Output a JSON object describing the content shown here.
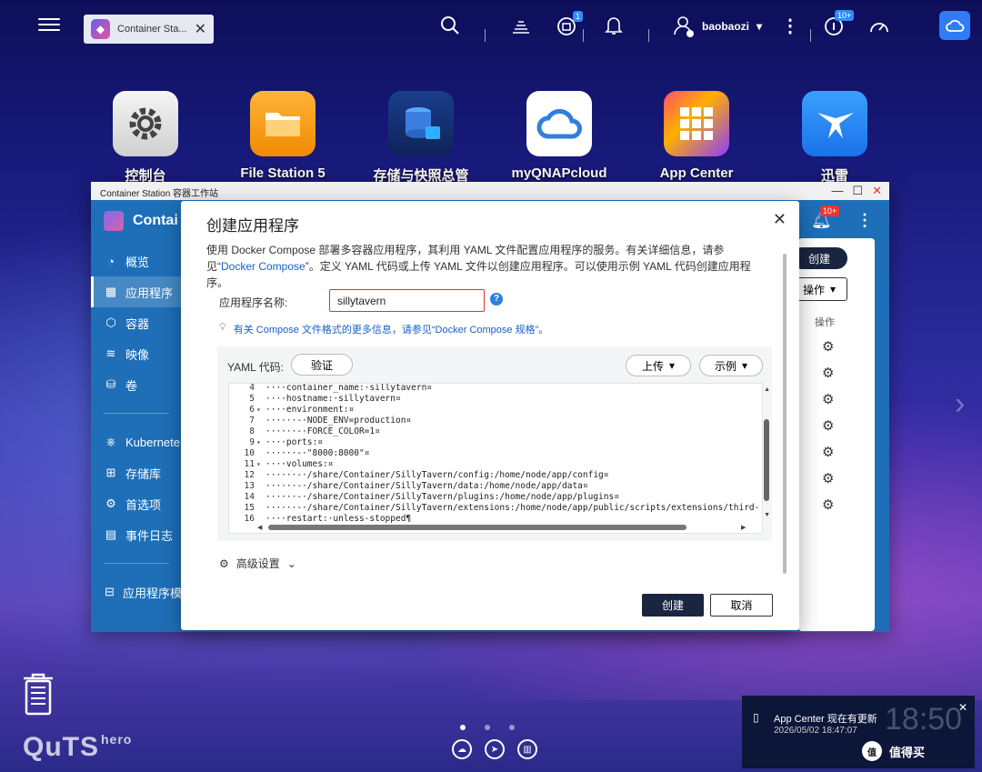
{
  "topbar": {
    "tab_label": "Container Sta...",
    "user": "baobaozi",
    "badge_updates": "1",
    "badge_notices": "10+"
  },
  "desktop": [
    {
      "label": "控制台",
      "icon": "gear-icon"
    },
    {
      "label": "File Station 5",
      "icon": "folder-icon"
    },
    {
      "label": "存储与快照总管",
      "icon": "storage-icon"
    },
    {
      "label": "myQNAPcloud",
      "icon": "cloud-icon"
    },
    {
      "label": "App Center",
      "icon": "app-grid-icon"
    },
    {
      "label": "迅雷",
      "icon": "bird-icon"
    }
  ],
  "window": {
    "title": "Container Station 容器工作站",
    "app_name": "Contai",
    "bell_badge": "10+",
    "sidebar": [
      {
        "label": "概览",
        "icon": "gauge-icon"
      },
      {
        "label": "应用程序",
        "icon": "apps-icon"
      },
      {
        "label": "容器",
        "icon": "cube-icon"
      },
      {
        "label": "映像",
        "icon": "layers-icon"
      },
      {
        "label": "卷",
        "icon": "database-icon"
      },
      {
        "label": "Kubernete",
        "icon": "helm-icon"
      },
      {
        "label": "存储库",
        "icon": "repo-icon"
      },
      {
        "label": "首选项",
        "icon": "settings-icon"
      },
      {
        "label": "事件日志",
        "icon": "log-icon"
      },
      {
        "label": "应用程序模",
        "icon": "template-icon"
      }
    ],
    "create_label": "创建",
    "action_label": "操作",
    "action_header": "操作"
  },
  "modal": {
    "title": "创建应用程序",
    "description_part1": "使用 Docker Compose 部署多容器应用程序，其利用 YAML 文件配置应用程序的服务。有关详细信息，请参见“",
    "description_link": "Docker Compose",
    "description_part2": "”。定义 YAML 代码或上传 YAML 文件以创建应用程序。可以使用示例 YAML 代码创建应用程序。",
    "name_label": "应用程序名称:",
    "name_value": "sillytavern",
    "hint_text": "有关 Compose 文件格式的更多信息，请参见“Docker Compose 规格”。",
    "yaml_label": "YAML 代码:",
    "verify_label": "验证",
    "upload_label": "上传",
    "example_label": "示例",
    "code_lines": [
      {
        "n": "4",
        "fold": "",
        "text": "····container_name:·sillytavern¤"
      },
      {
        "n": "5",
        "fold": "",
        "text": "····hostname:·sillytavern¤"
      },
      {
        "n": "6",
        "fold": "▾",
        "text": "····environment:¤"
      },
      {
        "n": "7",
        "fold": "",
        "text": "······-·NODE_ENV=production¤"
      },
      {
        "n": "8",
        "fold": "",
        "text": "······-·FORCE_COLOR=1¤"
      },
      {
        "n": "9",
        "fold": "▾",
        "text": "····ports:¤"
      },
      {
        "n": "10",
        "fold": "",
        "text": "······-·\"8000:8000\"¤"
      },
      {
        "n": "11",
        "fold": "▾",
        "text": "····volumes:¤"
      },
      {
        "n": "12",
        "fold": "",
        "text": "······-·/share/Container/SillyTavern/config:/home/node/app/config¤"
      },
      {
        "n": "13",
        "fold": "",
        "text": "······-·/share/Container/SillyTavern/data:/home/node/app/data¤"
      },
      {
        "n": "14",
        "fold": "",
        "text": "······-·/share/Container/SillyTavern/plugins:/home/node/app/plugins¤"
      },
      {
        "n": "15",
        "fold": "",
        "text": "······-·/share/Container/SillyTavern/extensions:/home/node/app/public/scripts/extensions/third-"
      },
      {
        "n": "16",
        "fold": "",
        "text": "····restart:·unless-stopped¶"
      }
    ],
    "advanced_label": "高级设置",
    "create_label": "创建",
    "cancel_label": "取消"
  },
  "notification": {
    "title": "App Center 现在有更新",
    "time": "2026/05/02 18:47:07"
  },
  "clock": "18:50",
  "brand": "QuTS",
  "brand_suffix": "hero",
  "watermark": "值得买"
}
